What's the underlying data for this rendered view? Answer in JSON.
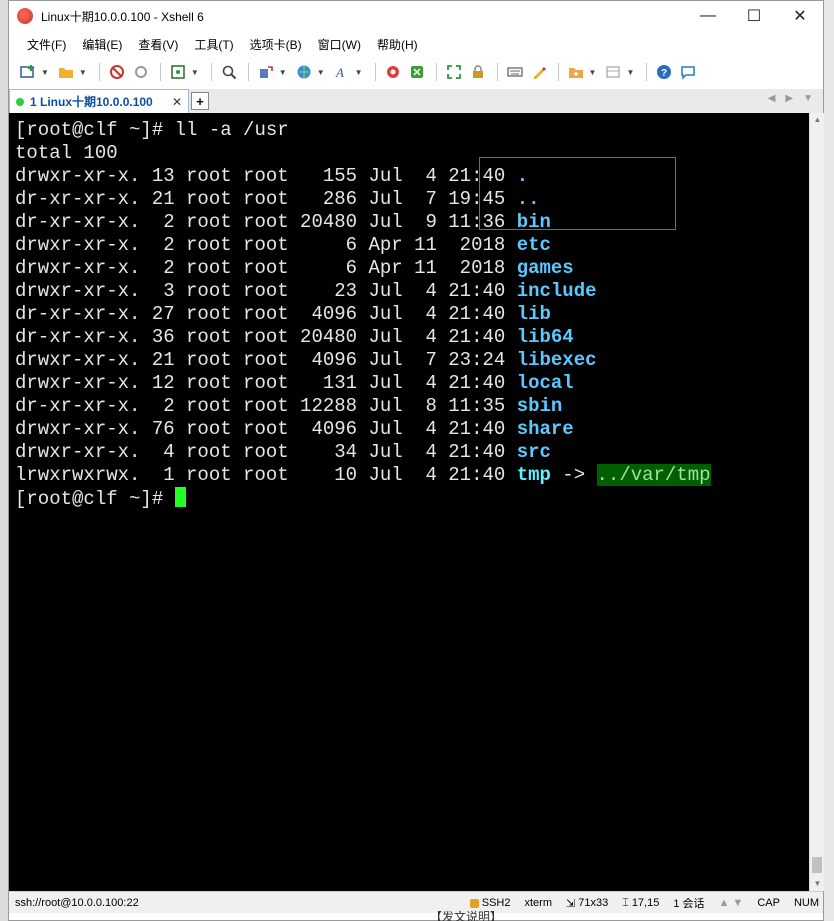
{
  "window": {
    "title": "Linux十期10.0.0.100 - Xshell 6",
    "minimize": "—",
    "maximize": "☐",
    "close": "✕"
  },
  "menu": [
    {
      "label": "文件(F)"
    },
    {
      "label": "编辑(E)"
    },
    {
      "label": "查看(V)"
    },
    {
      "label": "工具(T)"
    },
    {
      "label": "选项卡(B)"
    },
    {
      "label": "窗口(W)"
    },
    {
      "label": "帮助(H)"
    }
  ],
  "tab": {
    "label": "1 Linux十期10.0.0.100",
    "close": "✕",
    "add": "+"
  },
  "terminal": {
    "prompt": "[root@clf ~]# ",
    "command": "ll -a /usr",
    "total": "total 100",
    "rows": [
      {
        "meta": "drwxr-xr-x. 13 root root   155 Jul  4 21:40 ",
        "name": "."
      },
      {
        "meta": "dr-xr-xr-x. 21 root root   286 Jul  7 19:45 ",
        "name": ".."
      },
      {
        "meta": "dr-xr-xr-x.  2 root root 20480 Jul  9 11:36 ",
        "name": "bin"
      },
      {
        "meta": "drwxr-xr-x.  2 root root     6 Apr 11  2018 ",
        "name": "etc"
      },
      {
        "meta": "drwxr-xr-x.  2 root root     6 Apr 11  2018 ",
        "name": "games"
      },
      {
        "meta": "drwxr-xr-x.  3 root root    23 Jul  4 21:40 ",
        "name": "include"
      },
      {
        "meta": "dr-xr-xr-x. 27 root root  4096 Jul  4 21:40 ",
        "name": "lib"
      },
      {
        "meta": "dr-xr-xr-x. 36 root root 20480 Jul  4 21:40 ",
        "name": "lib64"
      },
      {
        "meta": "drwxr-xr-x. 21 root root  4096 Jul  7 23:24 ",
        "name": "libexec"
      },
      {
        "meta": "drwxr-xr-x. 12 root root   131 Jul  4 21:40 ",
        "name": "local"
      },
      {
        "meta": "dr-xr-xr-x.  2 root root 12288 Jul  8 11:35 ",
        "name": "sbin"
      },
      {
        "meta": "drwxr-xr-x. 76 root root  4096 Jul  4 21:40 ",
        "name": "share"
      },
      {
        "meta": "drwxr-xr-x.  4 root root    34 Jul  4 21:40 ",
        "name": "src"
      }
    ],
    "symlink": {
      "meta": "lrwxrwxrwx.  1 root root    10 Jul  4 21:40 ",
      "name": "tmp",
      "arrow": " -> ",
      "target": "../var/tmp"
    },
    "final_prompt": "[root@clf ~]# "
  },
  "status": {
    "connection": "ssh://root@10.0.0.100:22",
    "protocol": "SSH2",
    "term": "xterm",
    "size": "71x33",
    "position": "17,15",
    "sessions": "1 会话",
    "caps": "CAP",
    "num": "NUM"
  },
  "background_text": "【发文说明】",
  "colors": {
    "terminal_bg": "#000000",
    "directory": "#5dc8ff",
    "cursor": "#22ff22",
    "symlink_target_bg": "#005f00",
    "highlight_box": "#e53b3b"
  }
}
